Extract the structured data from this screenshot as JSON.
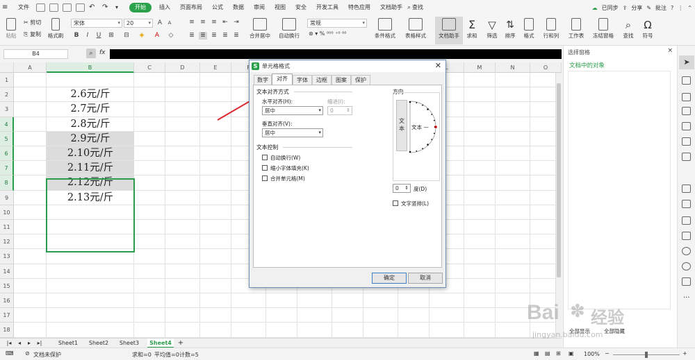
{
  "menu": {
    "file": "文件",
    "tabs": [
      "开始",
      "插入",
      "页面布局",
      "公式",
      "数据",
      "审阅",
      "视图",
      "安全",
      "开发工具",
      "特色应用",
      "文档助手"
    ],
    "search": "查找",
    "sync": "已同步",
    "share": "分享",
    "annotate": "批注"
  },
  "ribbon": {
    "cut": "剪切",
    "copy": "复制",
    "paste": "粘贴",
    "format_painter": "格式刷",
    "font_name": "宋体",
    "font_size": "20",
    "merge_center": "合并居中",
    "wrap_text": "自动换行",
    "number_format": "常规",
    "cond_format": "条件格式",
    "table_style": "表格样式",
    "doc_helper": "文档助手",
    "sum": "求和",
    "filter": "筛选",
    "sort": "排序",
    "format": "格式",
    "rows_cols": "行和列",
    "worksheet": "工作表",
    "freeze": "冻结窗格",
    "find": "查找",
    "symbol": "符号"
  },
  "formula": {
    "name_box": "B4",
    "fx": "fx"
  },
  "grid": {
    "columns": [
      "A",
      "B",
      "C",
      "D",
      "E",
      "F",
      "G",
      "H",
      "I",
      "J",
      "K",
      "L",
      "M",
      "N",
      "O",
      "P"
    ],
    "rows": [
      "1",
      "2",
      "3",
      "4",
      "5",
      "6",
      "7",
      "8",
      "9",
      "10",
      "11",
      "12",
      "13",
      "14",
      "15",
      "16",
      "17",
      "18"
    ],
    "b_values": [
      "",
      "2.6元/斤",
      "2.7元/斤",
      "2.8元/斤",
      "2.9元/斤",
      "2.10元/斤",
      "2.11元/斤",
      "2.12元/斤",
      "2.13元/斤"
    ]
  },
  "sheets": {
    "tabs": [
      "Sheet1",
      "Sheet2",
      "Sheet3",
      "Sheet4"
    ],
    "active": "Sheet4"
  },
  "status": {
    "protect": "文档未保护",
    "sum": "求和=0",
    "average": "平均值=0",
    "count": "计数=5",
    "zoom": "100%"
  },
  "pane": {
    "title": "选择窗格",
    "subtitle": "文档中的对象",
    "show_all": "全部显示",
    "hide_all": "全部隐藏"
  },
  "dialog": {
    "title": "单元格格式",
    "tabs": [
      "数字",
      "对齐",
      "字体",
      "边框",
      "图案",
      "保护"
    ],
    "active_tab": "对齐",
    "text_align_group": "文本对齐方式",
    "horizontal_label": "水平对齐(H):",
    "horizontal_value": "居中",
    "indent_label": "缩进(I):",
    "indent_value": "0",
    "vertical_label": "垂直对齐(V):",
    "vertical_value": "居中",
    "text_control_group": "文本控制",
    "wrap": "自动换行(W)",
    "shrink": "缩小字体填充(K)",
    "merge": "合并单元格(M)",
    "orientation_group": "方向",
    "vertical_text": "文本",
    "dial_text": "文本 —",
    "degree_value": "0",
    "degree_label": "度(D)",
    "vertical_text_option": "文字竖排(L)",
    "ok": "确定",
    "cancel": "取消"
  },
  "watermark": {
    "brand": "Bai",
    "brand2": "经验",
    "url": "jingyan.baidu.com"
  },
  "colors": {
    "accent": "#2aa14a",
    "selection": "#2a9d4a",
    "arrow": "#d9262c",
    "dialog_border": "#6b8fb8"
  }
}
